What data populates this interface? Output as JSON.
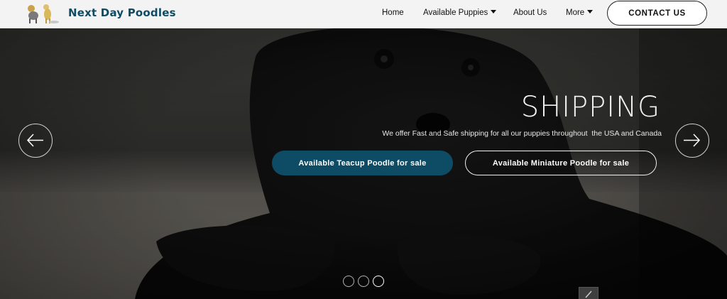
{
  "header": {
    "brand": "Next Day Poodles",
    "logo_icon": "poodles-logo-icon",
    "nav": [
      {
        "label": "Home",
        "has_caret": false
      },
      {
        "label": "Available Puppies",
        "has_caret": true
      },
      {
        "label": "About Us",
        "has_caret": false
      },
      {
        "label": "More",
        "has_caret": true
      }
    ],
    "contact_label": "CONTACT US"
  },
  "hero": {
    "title": "SHIPPING",
    "subtitle": "We offer Fast and Safe shipping for all our puppies throughout  the USA and Canada",
    "cta_teacup": "Available Teacup Poodle for sale",
    "cta_miniature": "Available Miniature Poodle for sale",
    "slides_count": 3,
    "active_slide": 3
  },
  "colors": {
    "brand": "#0f4b63",
    "cta_primary": "#0e4c65",
    "header_bg": "#f3f3f3"
  }
}
